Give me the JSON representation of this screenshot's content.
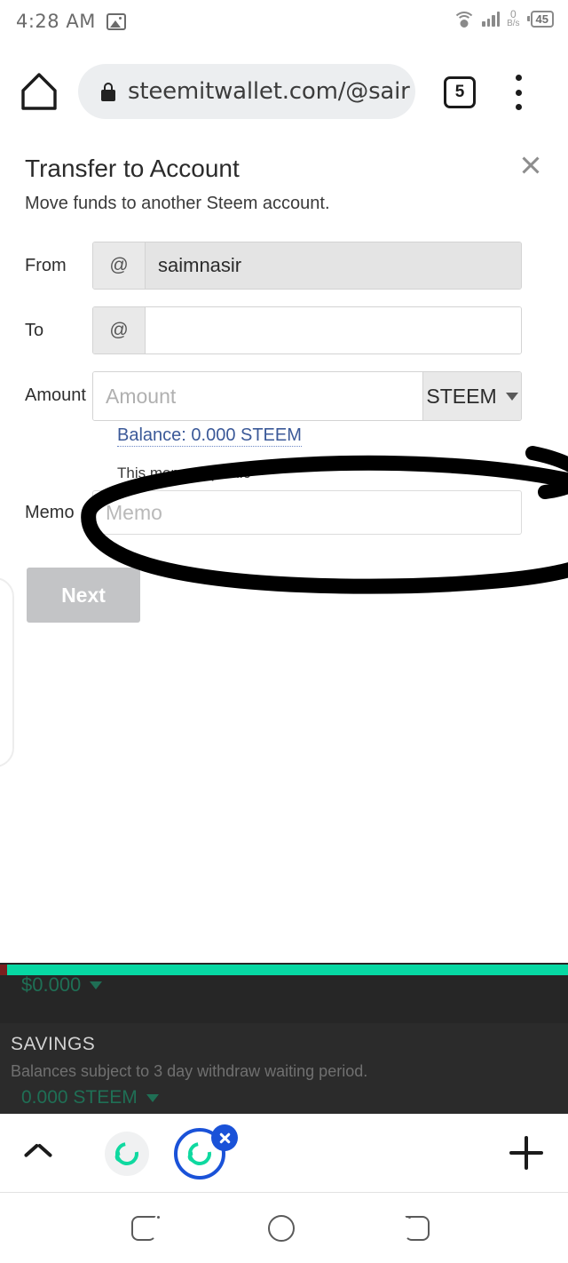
{
  "status_bar": {
    "time": "4:28 AM",
    "image_icon": "image-icon",
    "wifi_icon": "wifi-icon",
    "signal_icon": "cellular-signal-icon",
    "network_speed_value": "0",
    "network_speed_unit": "B/s",
    "battery_level": "45"
  },
  "browser": {
    "home_icon": "home-icon",
    "lock_icon": "lock-icon",
    "url": "steemitwallet.com/@sair",
    "tab_count": "5",
    "menu_icon": "kebab-menu-icon"
  },
  "dialog": {
    "title": "Transfer to Account",
    "subtitle": "Move funds to another Steem account.",
    "close_icon": "close-icon",
    "fields": {
      "from": {
        "label": "From",
        "prefix": "@",
        "value": "saimnasir",
        "placeholder": ""
      },
      "to": {
        "label": "To",
        "prefix": "@",
        "value": "",
        "placeholder": ""
      },
      "amount": {
        "label": "Amount",
        "placeholder": "Amount",
        "value": "",
        "asset": "STEEM",
        "balance_link": "Balance: 0.000 STEEM"
      },
      "memo": {
        "label": "Memo",
        "hint": "This memo is public",
        "placeholder": "Memo",
        "value": ""
      }
    },
    "next_button": "Next"
  },
  "wallet_strip": {
    "usd_value": "$0.000",
    "savings_title": "SAVINGS",
    "savings_note": "Balances subject to 3 day withdraw waiting period.",
    "savings_amount": "0.000 STEEM"
  },
  "tab_strip": {
    "expand_icon": "chevron-up-icon",
    "tab_1_icon": "steem-favicon",
    "tab_2_icon": "steem-favicon",
    "close_tab_icon": "close-tab-icon",
    "new_tab_icon": "plus-icon"
  },
  "nav_bar": {
    "recents_icon": "recents-icon",
    "home_icon": "home-circle-icon",
    "back_icon": "back-icon"
  },
  "annotation": {
    "type": "hand-drawn-ellipse",
    "color": "#000000",
    "target": "memo-field"
  },
  "colors": {
    "accent_green": "#07d8a3",
    "link_blue": "#3b5998",
    "tab_blue": "#1a52d8",
    "dark_panel": "#262626"
  }
}
